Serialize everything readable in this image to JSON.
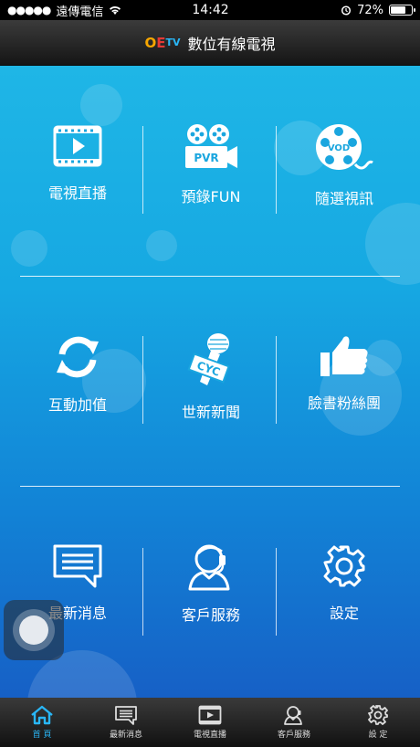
{
  "status_bar": {
    "carrier": "遠傳電信",
    "signal_dots": "●●●●●",
    "time": "14:42",
    "battery": "72%",
    "battery_level": 0.72
  },
  "header": {
    "logo_text": {
      "a": "O",
      "b": "E",
      "c": "TV"
    },
    "title": "數位有線電視"
  },
  "grid": [
    {
      "label": "電視直播",
      "icon": "tv-play-icon"
    },
    {
      "label": "預錄FUN",
      "icon": "pvr-camera-icon"
    },
    {
      "label": "隨選視訊",
      "icon": "vod-film-icon"
    },
    {
      "label": "互動加值",
      "icon": "refresh-icon"
    },
    {
      "label": "世新新聞",
      "icon": "cyc-microphone-icon"
    },
    {
      "label": "臉書粉絲團",
      "icon": "thumbs-up-icon"
    },
    {
      "label": "最新消息",
      "icon": "message-icon"
    },
    {
      "label": "客戶服務",
      "icon": "customer-service-icon"
    },
    {
      "label": "設定",
      "icon": "gear-icon"
    }
  ],
  "icon_text": {
    "pvr": "PVR",
    "vod": "VOD",
    "cyc": "CYC"
  },
  "tabs": [
    {
      "label": "首 頁",
      "icon": "home-icon",
      "active": true
    },
    {
      "label": "最新消息",
      "icon": "message-icon"
    },
    {
      "label": "電視直播",
      "icon": "tv-play-icon"
    },
    {
      "label": "客戶服務",
      "icon": "customer-service-icon"
    },
    {
      "label": "設 定",
      "icon": "gear-icon"
    }
  ],
  "colors": {
    "accent": "#29b6f6",
    "bg_top": "#1fb6e6",
    "bg_bottom": "#1660c6"
  }
}
